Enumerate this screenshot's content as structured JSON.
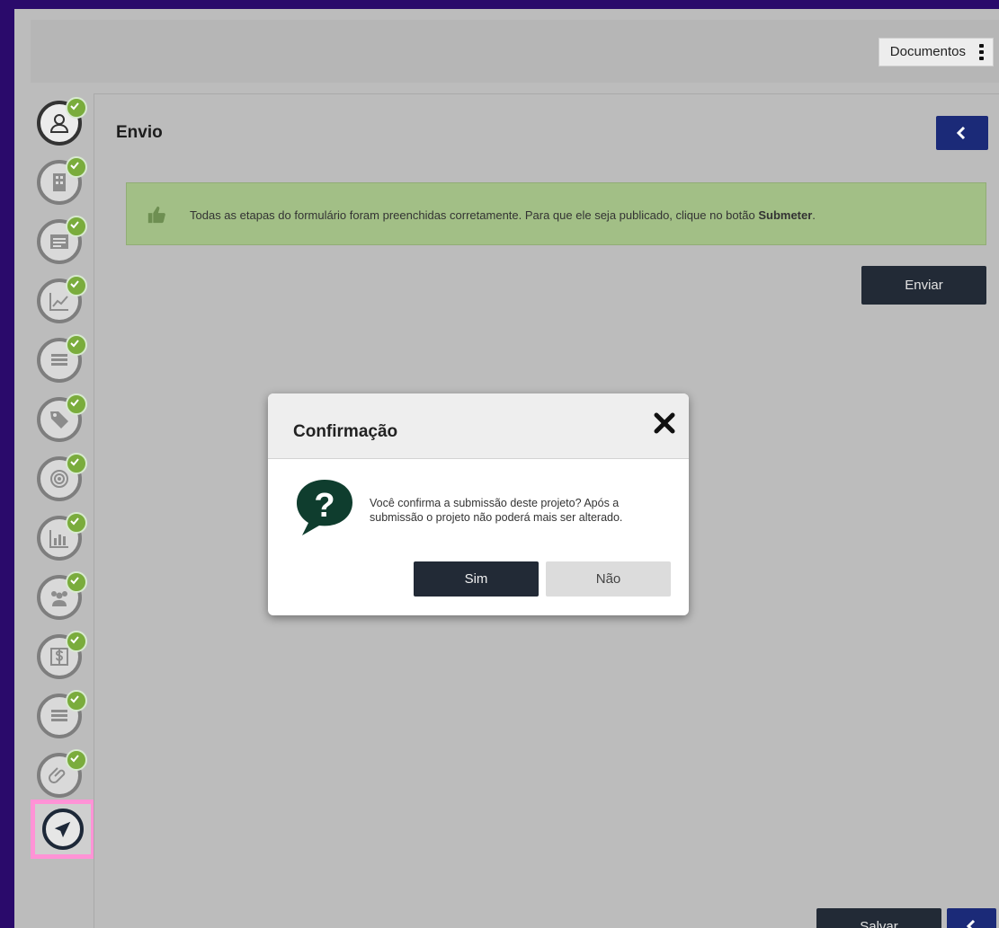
{
  "header": {
    "documents_label": "Documentos"
  },
  "sidebar": {
    "steps": [
      {
        "icon": "user-icon",
        "completed": true
      },
      {
        "icon": "building-icon",
        "completed": true
      },
      {
        "icon": "form-icon",
        "completed": true
      },
      {
        "icon": "chart-line-icon",
        "completed": true
      },
      {
        "icon": "list-icon",
        "completed": true
      },
      {
        "icon": "tag-icon",
        "completed": true
      },
      {
        "icon": "target-icon",
        "completed": true
      },
      {
        "icon": "bar-chart-icon",
        "completed": true
      },
      {
        "icon": "team-icon",
        "completed": true
      },
      {
        "icon": "dollar-icon",
        "completed": true
      },
      {
        "icon": "list-icon",
        "completed": true
      },
      {
        "icon": "paperclip-icon",
        "completed": true
      },
      {
        "icon": "paper-plane-icon",
        "completed": false,
        "active": true
      }
    ],
    "check_color": "#7aac3c",
    "active_highlight_color": "#ff93d6"
  },
  "main": {
    "title": "Envio",
    "alert": {
      "text": "Todas as etapas do formulário foram preenchidas corretamente. Para que ele seja publicado, clique no botão ",
      "bold": "Submeter",
      "end": "."
    },
    "send_label": "Enviar"
  },
  "footer": {
    "save_label": "Salvar"
  },
  "modal": {
    "title": "Confirmação",
    "message": "Você confirma a submissão deste projeto? Após a submissão o projeto não poderá mais ser alterado.",
    "yes_label": "Sim",
    "no_label": "Não"
  },
  "colors": {
    "primary_dark": "#222a36",
    "back_button": "#1b2a78",
    "success_bg": "#a2bf86",
    "question_icon": "#0f3d2e"
  }
}
